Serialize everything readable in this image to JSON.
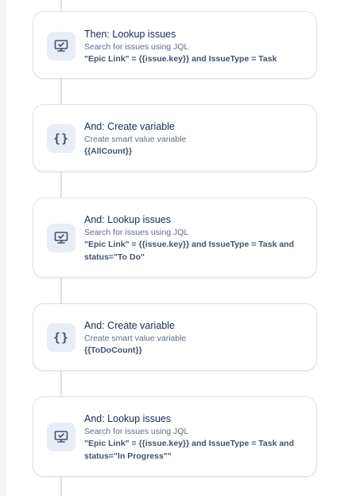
{
  "steps": [
    {
      "icon": "monitor-check-icon",
      "title": "Then: Lookup issues",
      "description": "Search for issues using JQL",
      "detail": "\"Epic Link\" = {{issue.key}} and IssueType = Task"
    },
    {
      "icon": "braces-icon",
      "title": "And: Create variable",
      "description": "Create smart value variable",
      "detail": "{{AllCount}}"
    },
    {
      "icon": "monitor-check-icon",
      "title": "And: Lookup issues",
      "description": "Search for issues using JQL",
      "detail": "\"Epic Link\" = {{issue.key}} and IssueType = Task and status=\"To Do\""
    },
    {
      "icon": "braces-icon",
      "title": "And: Create variable",
      "description": "Create smart value variable",
      "detail": "{{ToDoCount}}"
    },
    {
      "icon": "monitor-check-icon",
      "title": "And: Lookup issues",
      "description": "Search for issues using JQL",
      "detail": "\"Epic Link\" = {{issue.key}} and IssueType = Task and status=\"In Progress\"\""
    }
  ],
  "colors": {
    "icon_tint": "#6b778c",
    "icon_bg": "#e9edf8",
    "title": "#172b4d",
    "description": "#5e6c84"
  }
}
